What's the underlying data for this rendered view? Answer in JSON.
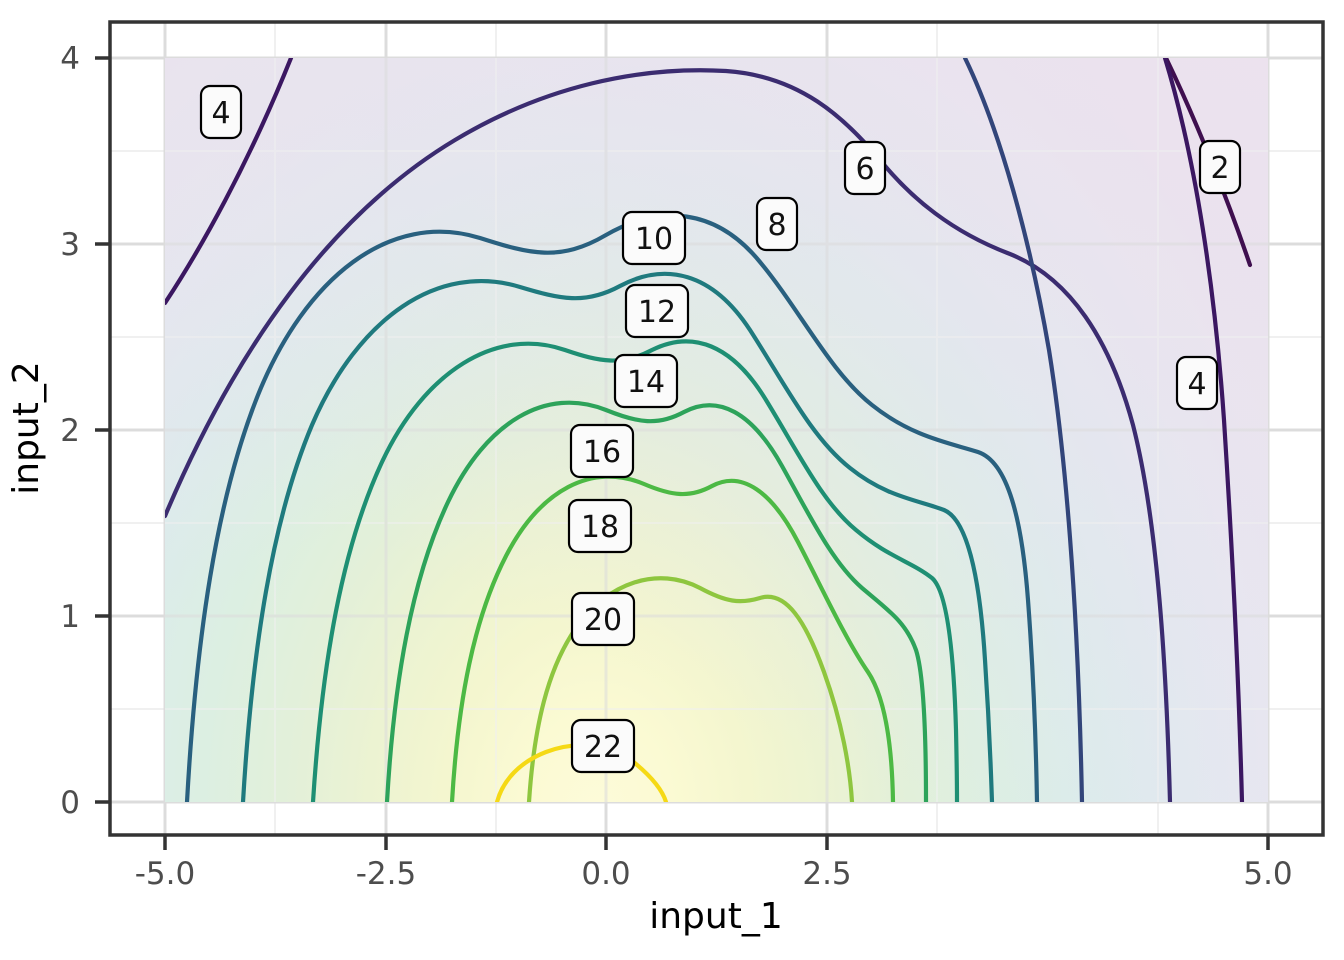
{
  "figure": {
    "type": "contour-plot",
    "background_color": "#ffffff",
    "panel_background": "#ffffff",
    "panel_border_color": "#333333"
  },
  "axes": {
    "x": {
      "title": "input_1",
      "ticks": [
        "-5.0",
        "-2.5",
        "0.0",
        "2.5",
        "5.0"
      ],
      "tick_values": [
        -5,
        -2.5,
        0,
        2.5,
        5
      ],
      "range": [
        -5.55,
        5.55
      ]
    },
    "y": {
      "title": "input_2",
      "ticks": [
        "0",
        "1",
        "2",
        "3",
        "4"
      ],
      "tick_values": [
        0,
        1,
        2,
        3,
        4
      ],
      "range": [
        -0.2,
        4.2
      ]
    }
  },
  "chart_data": {
    "type": "contour",
    "title": "",
    "xlabel": "input_1",
    "ylabel": "input_2",
    "xlim": [
      -5.55,
      5.55
    ],
    "ylim": [
      -0.2,
      4.2
    ],
    "grid": true,
    "legend": "none",
    "colormap": "viridis",
    "x_data_range": [
      -5,
      5
    ],
    "y_data_range": [
      0,
      4
    ],
    "contour_levels": [
      2,
      4,
      6,
      8,
      10,
      12,
      14,
      16,
      18,
      20,
      22
    ],
    "level_colors": {
      "2": "#3f0f4f",
      "4": "#3b1761",
      "6": "#3b2c70",
      "8": "#32457a",
      "10": "#29607f",
      "12": "#1f7a7e",
      "14": "#1e8f73",
      "16": "#2da35a",
      "18": "#4cb944",
      "20": "#8ec63f",
      "22": "#f5d915"
    },
    "labels": [
      {
        "level": 2,
        "x": 4.58,
        "y": 3.48
      },
      {
        "level": 4,
        "x": -4.55,
        "y": 3.72
      },
      {
        "level": 4,
        "x": 4.43,
        "y": 2.29
      },
      {
        "level": 6,
        "x": 1.98,
        "y": 3.46
      },
      {
        "level": 8,
        "x": 0.46,
        "y": 3.05
      },
      {
        "level": 10,
        "x": -0.97,
        "y": 3.05
      },
      {
        "level": 12,
        "x": -0.82,
        "y": 2.66
      },
      {
        "level": 14,
        "x": -1.18,
        "y": 2.25
      },
      {
        "level": 16,
        "x": -1.48,
        "y": 1.91
      },
      {
        "level": 18,
        "x": -1.58,
        "y": 1.5
      },
      {
        "level": 20,
        "x": -1.62,
        "y": 1.0
      },
      {
        "level": 22,
        "x": -1.57,
        "y": 0.28
      }
    ],
    "fill_description": "Smooth viridis-style raster: bright yellow peak near (-1.2, 0) falling off to pale blue-grey at the panel edges and faint purple in the upper corners.",
    "peak_value_approx": 23,
    "min_value_approx": 1
  }
}
